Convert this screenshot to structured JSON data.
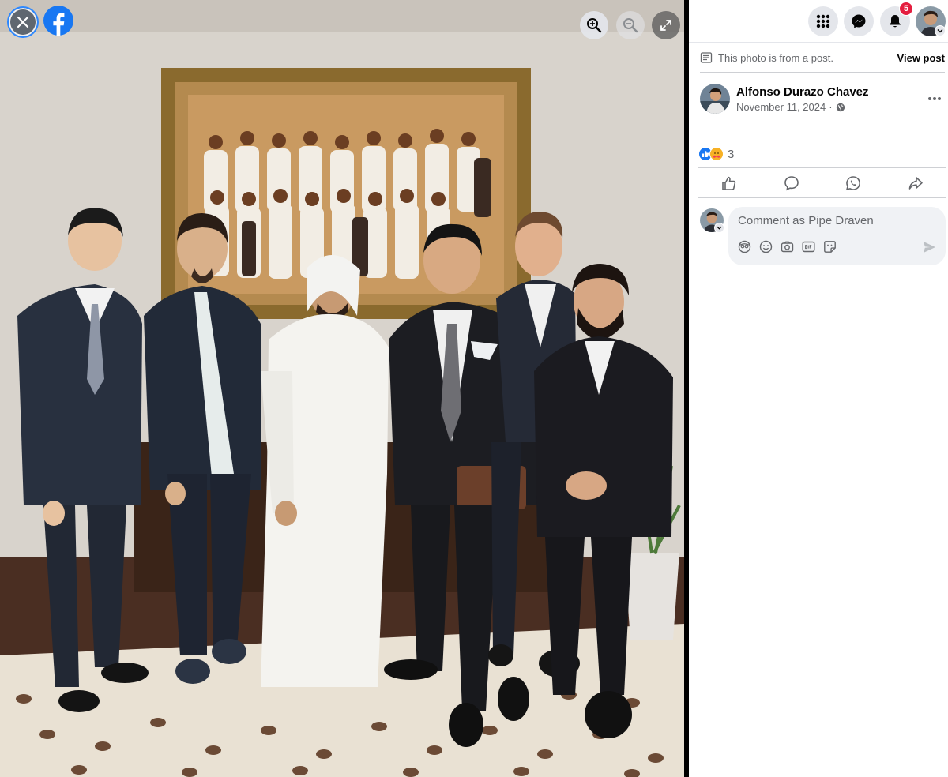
{
  "viewer": {
    "close_icon": "close-icon",
    "logo_icon": "facebook-logo-icon",
    "zoom_in_icon": "zoom-in-icon",
    "zoom_out_icon": "zoom-out-icon",
    "fullscreen_icon": "fullscreen-icon",
    "photo_subject": "group photo of seven men in front of a framed painting"
  },
  "topbar": {
    "menu_icon": "grid-menu-icon",
    "messenger_icon": "messenger-icon",
    "notifications_icon": "bell-icon",
    "notification_count": "5",
    "account_caret_icon": "chevron-down-icon"
  },
  "post_note": {
    "icon": "post-document-icon",
    "text": "This photo is from a post.",
    "view_post_label": "View post"
  },
  "author": {
    "name": "Alfonso Durazo Chavez",
    "date": "November 11, 2024",
    "separator": "·",
    "privacy_icon": "globe-icon",
    "more_icon": "more-options-icon"
  },
  "reactions": {
    "icons": [
      "like-reaction-icon",
      "care-reaction-icon"
    ],
    "count": "3",
    "colors": {
      "like": "#1877f2",
      "care": "#f7b125"
    }
  },
  "actions": [
    {
      "icon": "like-icon"
    },
    {
      "icon": "comment-icon"
    },
    {
      "icon": "whatsapp-icon"
    },
    {
      "icon": "share-icon"
    }
  ],
  "comment": {
    "placeholder": "Comment as Pipe Draven",
    "tools": [
      "avatar-sticker-icon",
      "emoji-icon",
      "camera-icon",
      "gif-icon",
      "sticker-icon"
    ],
    "send_icon": "send-icon"
  },
  "colors": {
    "brand": "#1877f2",
    "badge": "#e41e3f",
    "secondary_text": "#65676b",
    "button_bg": "#e4e6eb"
  }
}
